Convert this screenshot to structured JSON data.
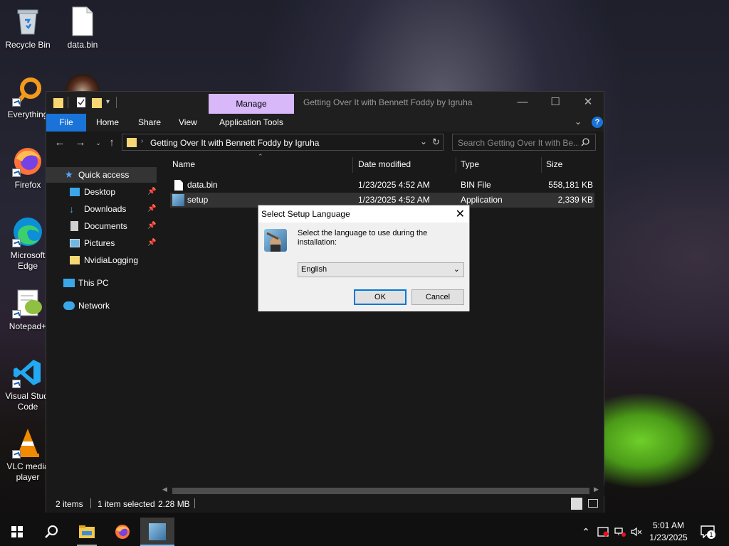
{
  "desktop": {
    "icons": [
      {
        "label": "Recycle Bin",
        "icon": "recycle-bin-icon"
      },
      {
        "label": "data.bin",
        "icon": "file-icon"
      },
      {
        "label": "Everything",
        "icon": "everything-icon"
      },
      {
        "label": "Firefox",
        "icon": "firefox-icon"
      },
      {
        "label": "Microsoft Edge",
        "line1": "Microsoft",
        "line2": "Edge",
        "icon": "edge-icon"
      },
      {
        "label": "Notepad+",
        "icon": "notepad-plus-icon"
      },
      {
        "label": "Visual Studio Code",
        "line1": "Visual Studi",
        "line2": "Code",
        "icon": "vscode-icon"
      },
      {
        "label": "VLC media player",
        "line1": "VLC media",
        "line2": "player",
        "icon": "vlc-icon"
      }
    ]
  },
  "explorer": {
    "manage_tab": "Manage",
    "title": "Getting Over It with Bennett Foddy by Igruha",
    "ribbon_tabs": [
      "File",
      "Home",
      "Share",
      "View",
      "Application Tools"
    ],
    "address_path": "Getting Over It with Bennett Foddy by Igruha",
    "search_placeholder": "Search Getting Over It with Be...",
    "nav": {
      "quick_access": "Quick access",
      "items": [
        "Desktop",
        "Downloads",
        "Documents",
        "Pictures",
        "NvidiaLogging"
      ],
      "this_pc": "This PC",
      "network": "Network"
    },
    "columns": [
      "Name",
      "Date modified",
      "Type",
      "Size"
    ],
    "files": [
      {
        "name": "data.bin",
        "date": "1/23/2025 4:52 AM",
        "type": "BIN File",
        "size": "558,181 KB"
      },
      {
        "name": "setup",
        "date": "1/23/2025 4:52 AM",
        "type": "Application",
        "size": "2,339 KB"
      }
    ],
    "status": {
      "items": "2 items",
      "selected": "1 item selected",
      "size": "2.28 MB"
    }
  },
  "dialog": {
    "title": "Select Setup Language",
    "prompt": "Select the language to use during the installation:",
    "selected_language": "English",
    "ok_label": "OK",
    "cancel_label": "Cancel"
  },
  "taskbar": {
    "time": "5:01 AM",
    "date": "1/23/2025",
    "notification_count": "1"
  },
  "colors": {
    "ribbon_file_tab": "#1a73d9",
    "manage_tab": "#d8b8f8",
    "dialog_default_button": "#0078d7"
  }
}
